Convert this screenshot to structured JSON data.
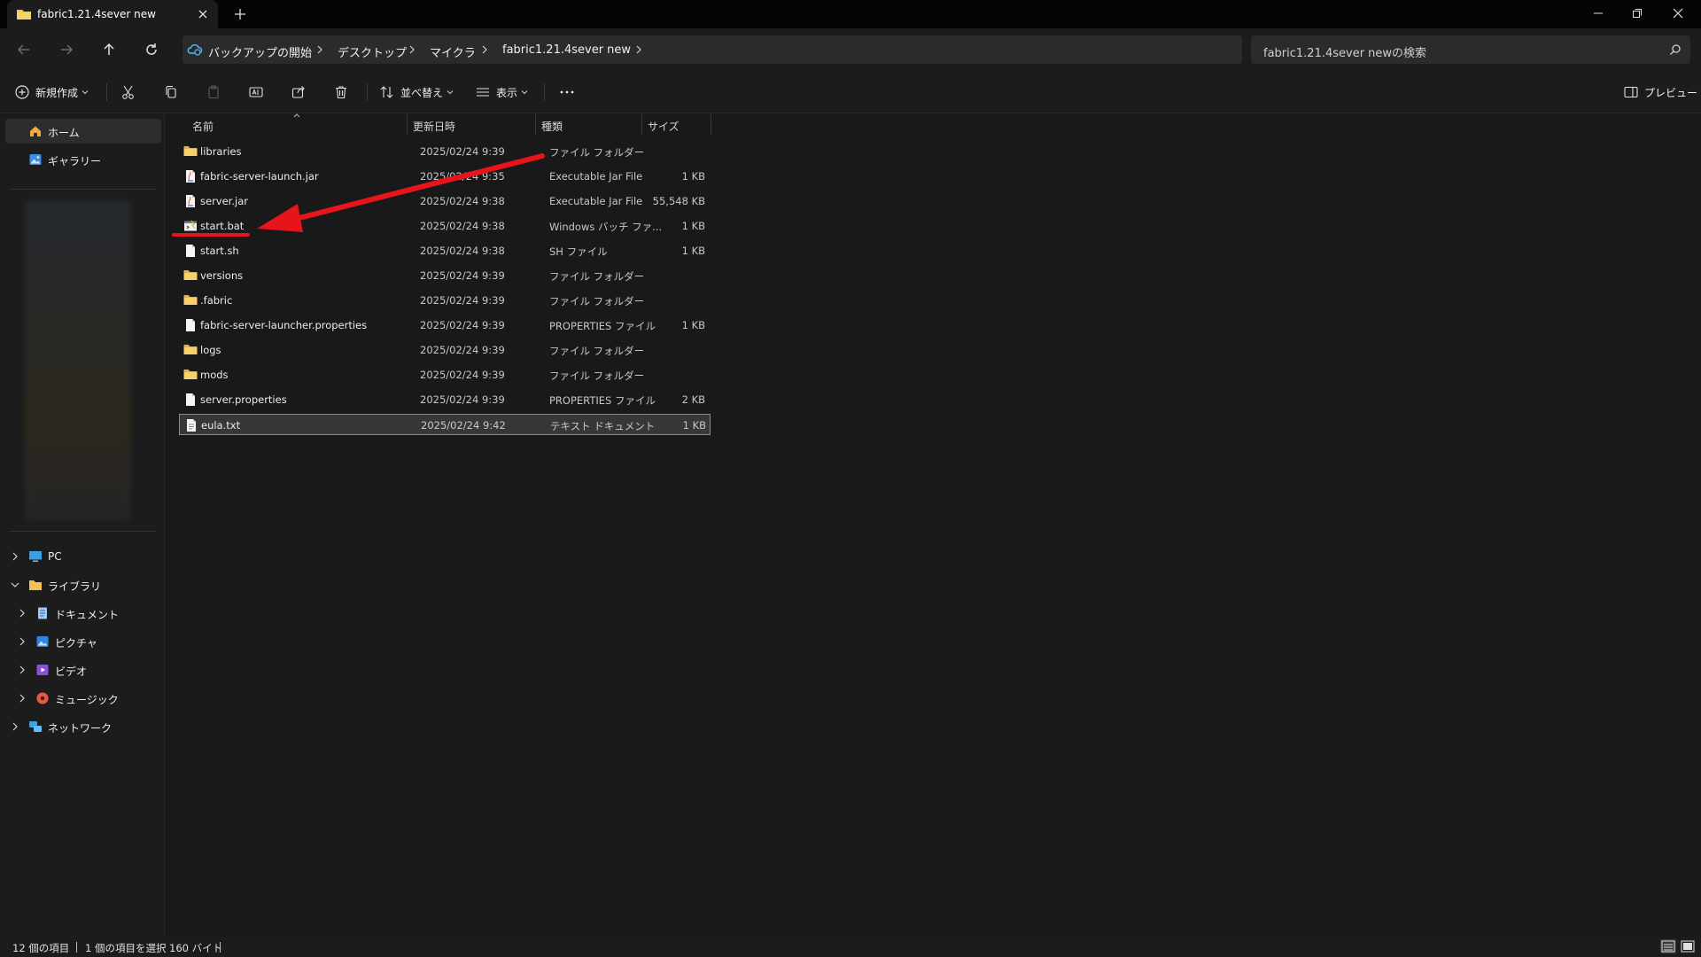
{
  "window": {
    "tab_title": "fabric1.21.4sever new"
  },
  "address_bar": {
    "breadcrumbs": [
      "バックアップの開始",
      "デスクトップ",
      "マイクラ",
      "fabric1.21.4sever new"
    ],
    "search_placeholder": "fabric1.21.4sever newの検索"
  },
  "toolbar": {
    "new_label": "新規作成",
    "sort_label": "並べ替え",
    "view_label": "表示",
    "preview_label": "プレビュー"
  },
  "sidebar": {
    "top_items": [
      {
        "label": "ホーム",
        "icon": "home-icon"
      },
      {
        "label": "ギャラリー",
        "icon": "gallery-icon"
      }
    ],
    "tree_items": [
      {
        "label": "PC",
        "icon": "pc-icon"
      },
      {
        "label": "ライブラリ",
        "icon": "library-folder-icon"
      },
      {
        "label": "ドキュメント",
        "icon": "documents-icon"
      },
      {
        "label": "ピクチャ",
        "icon": "pictures-icon"
      },
      {
        "label": "ビデオ",
        "icon": "videos-icon"
      },
      {
        "label": "ミュージック",
        "icon": "music-icon"
      },
      {
        "label": "ネットワーク",
        "icon": "network-icon"
      }
    ]
  },
  "columns": {
    "name": "名前",
    "modified": "更新日時",
    "type": "種類",
    "size": "サイズ"
  },
  "files": [
    {
      "name": "libraries",
      "modified": "2025/02/24 9:39",
      "type": "ファイル フォルダー",
      "size": "",
      "icon": "folder-icon"
    },
    {
      "name": "fabric-server-launch.jar",
      "modified": "2025/02/24 9:35",
      "type": "Executable Jar File",
      "size": "1 KB",
      "icon": "jar-file-icon"
    },
    {
      "name": "server.jar",
      "modified": "2025/02/24 9:38",
      "type": "Executable Jar File",
      "size": "55,548 KB",
      "icon": "jar-file-icon"
    },
    {
      "name": "start.bat",
      "modified": "2025/02/24 9:38",
      "type": "Windows バッチ ファ...",
      "size": "1 KB",
      "icon": "batch-file-icon"
    },
    {
      "name": "start.sh",
      "modified": "2025/02/24 9:38",
      "type": "SH ファイル",
      "size": "1 KB",
      "icon": "file-icon"
    },
    {
      "name": "versions",
      "modified": "2025/02/24 9:39",
      "type": "ファイル フォルダー",
      "size": "",
      "icon": "folder-icon"
    },
    {
      "name": ".fabric",
      "modified": "2025/02/24 9:39",
      "type": "ファイル フォルダー",
      "size": "",
      "icon": "folder-icon"
    },
    {
      "name": "fabric-server-launcher.properties",
      "modified": "2025/02/24 9:39",
      "type": "PROPERTIES ファイル",
      "size": "1 KB",
      "icon": "file-icon"
    },
    {
      "name": "logs",
      "modified": "2025/02/24 9:39",
      "type": "ファイル フォルダー",
      "size": "",
      "icon": "folder-icon"
    },
    {
      "name": "mods",
      "modified": "2025/02/24 9:39",
      "type": "ファイル フォルダー",
      "size": "",
      "icon": "folder-icon"
    },
    {
      "name": "server.properties",
      "modified": "2025/02/24 9:39",
      "type": "PROPERTIES ファイル",
      "size": "2 KB",
      "icon": "file-icon"
    },
    {
      "name": "eula.txt",
      "modified": "2025/02/24 9:42",
      "type": "テキスト ドキュメント",
      "size": "1 KB",
      "icon": "text-file-icon"
    }
  ],
  "selected_file": "eula.txt",
  "annotation": {
    "target": "start.bat",
    "color": "#e8141b"
  },
  "status": {
    "item_count": "12 個の項目",
    "selected": "1 個の項目を選択",
    "selected_size": "160 バイト"
  },
  "colors": {
    "background": "#191919",
    "folder": "#f2c34e",
    "annotation_red": "#e8141b"
  }
}
